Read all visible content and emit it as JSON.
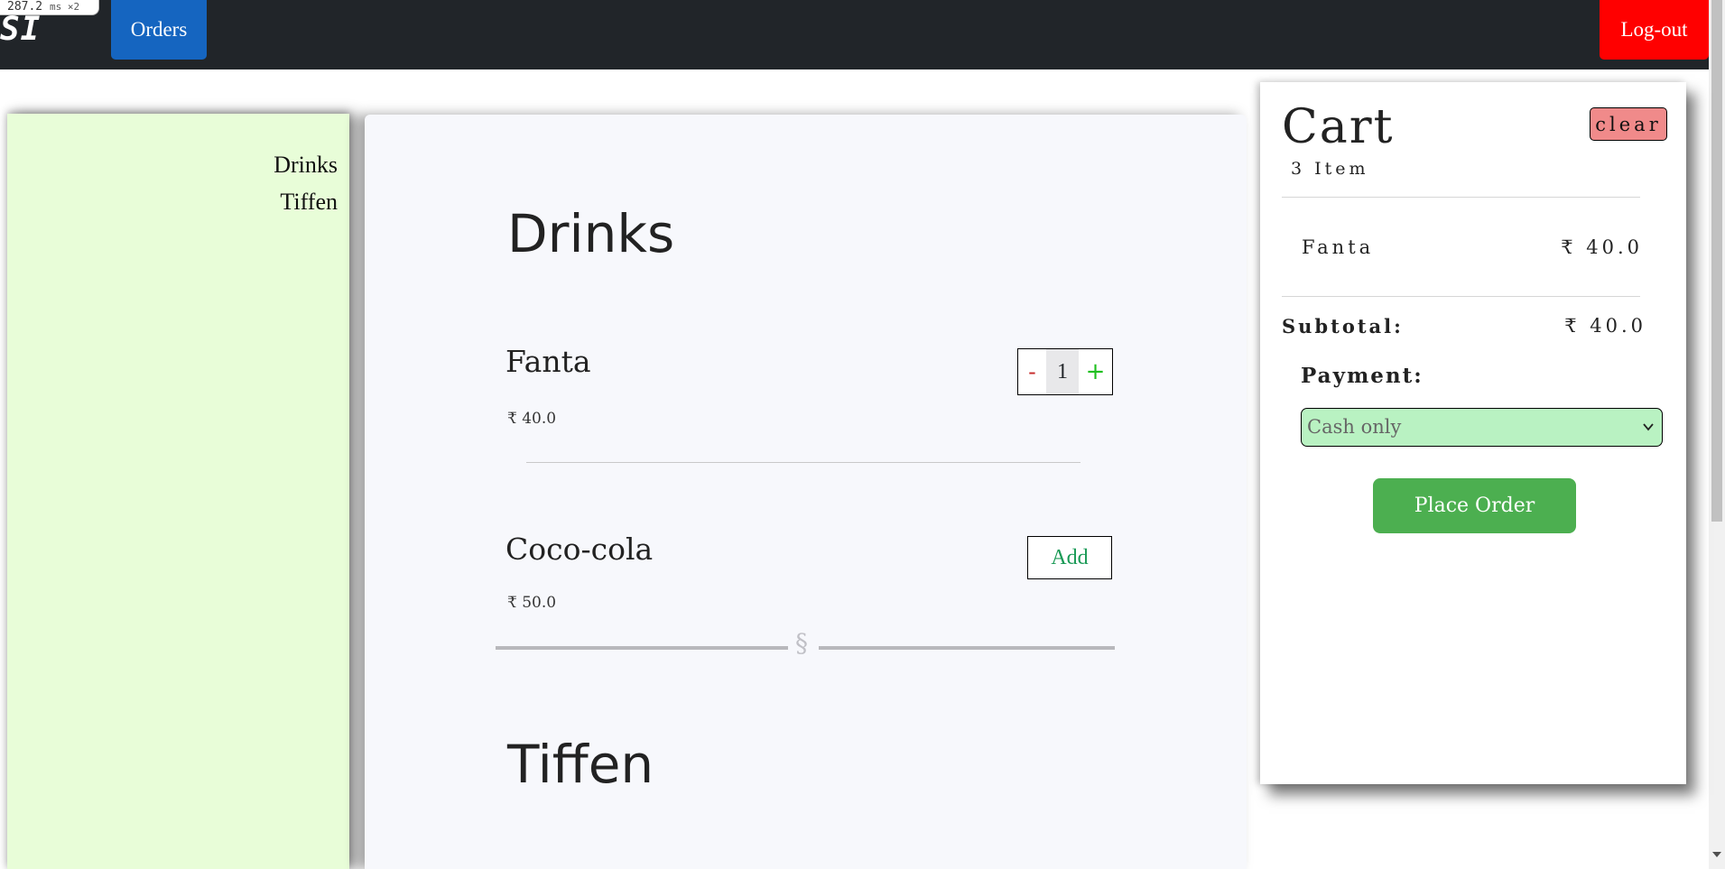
{
  "perf_badge": {
    "value": "287.2",
    "unit": "ms ×2"
  },
  "navbar": {
    "brand": "SI",
    "orders_label": "Orders",
    "logout_label": "Log-out"
  },
  "categories": [
    "Drinks",
    "Tiffen"
  ],
  "menu": {
    "sections": [
      {
        "title": "Drinks",
        "items": [
          {
            "name": "Fanta",
            "price": "₹ 40.0",
            "quantity": "1",
            "minus": "-",
            "plus": "+"
          },
          {
            "name": "Coco-cola",
            "price": "₹ 50.0",
            "add_label": "Add"
          }
        ],
        "divider_symbol": "§"
      },
      {
        "title": "Tiffen"
      }
    ]
  },
  "cart": {
    "title": "Cart",
    "count": "3 Item",
    "clear_label": "clear",
    "items": [
      {
        "name": "Fanta",
        "price": "₹ 40.0"
      }
    ],
    "subtotal_label": "Subtotal:",
    "subtotal_value": "₹ 40.0",
    "payment_label": "Payment:",
    "payment_selected": "Cash only",
    "place_order_label": "Place Order"
  },
  "colors": {
    "navbar": "#212529",
    "orders_button": "#1565c0",
    "logout_button": "#ff0000",
    "category_sidebar": "#e8fdd8",
    "clear_button": "#f08a8a",
    "payment_select": "#b9f2c2",
    "place_order_button": "#4caf50"
  }
}
